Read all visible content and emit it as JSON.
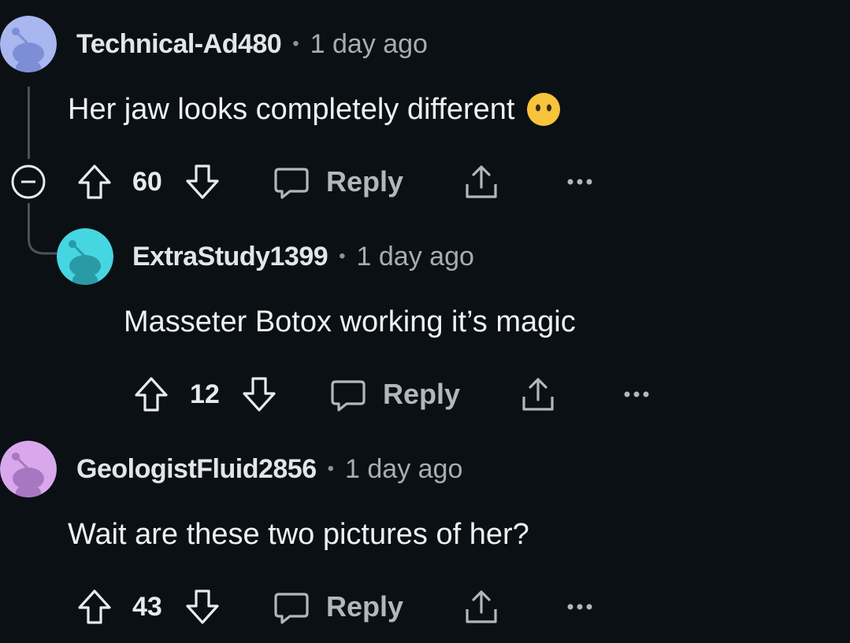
{
  "colors": {
    "background": "#0b1014",
    "avatar_1": "#a9b7f0",
    "avatar_2": "#45d6e2",
    "avatar_3": "#d9a8ec"
  },
  "comments": [
    {
      "username": "Technical-Ad480",
      "separator": "•",
      "time": "1 day ago",
      "text": "Her jaw looks completely different",
      "emoji": "😶",
      "score": "60",
      "reply_label": "Reply"
    },
    {
      "username": "ExtraStudy1399",
      "separator": "•",
      "time": "1 day ago",
      "text": "Masseter Botox working it’s magic",
      "score": "12",
      "reply_label": "Reply"
    },
    {
      "username": "GeologistFluid2856",
      "separator": "•",
      "time": "1 day ago",
      "text": "Wait are these two pictures of her?",
      "score": "43",
      "reply_label": "Reply"
    }
  ],
  "icons": {
    "collapse": "minus-circle-icon",
    "upvote": "arrow-up-icon",
    "downvote": "arrow-down-icon",
    "reply": "speech-bubble-icon",
    "share": "share-icon",
    "more": "ellipsis-icon"
  }
}
